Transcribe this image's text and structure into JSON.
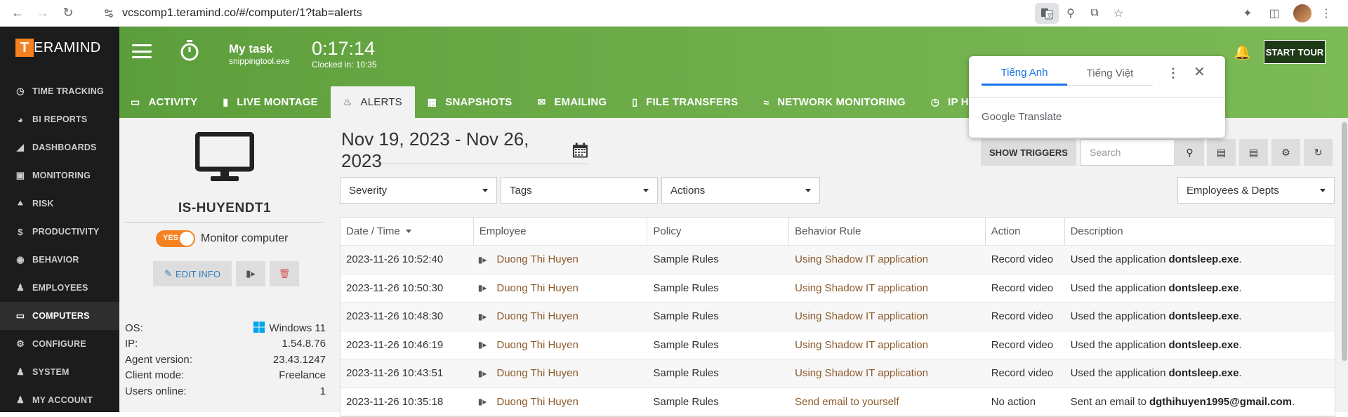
{
  "browser": {
    "url": "vcscomp1.teramind.co/#/computer/1?tab=alerts"
  },
  "sidebar": {
    "brand_letter": "T",
    "brand_name": "ERAMIND",
    "items": [
      {
        "label": "TIME TRACKING",
        "icon": "clock-icon"
      },
      {
        "label": "BI REPORTS",
        "icon": "pie-chart-icon"
      },
      {
        "label": "DASHBOARDS",
        "icon": "area-chart-icon"
      },
      {
        "label": "MONITORING",
        "icon": "monitoring-icon"
      },
      {
        "label": "RISK",
        "icon": "bolt-icon"
      },
      {
        "label": "PRODUCTIVITY",
        "icon": "dollar-icon"
      },
      {
        "label": "BEHAVIOR",
        "icon": "gamepad-icon"
      },
      {
        "label": "EMPLOYEES",
        "icon": "users-icon"
      },
      {
        "label": "COMPUTERS",
        "icon": "desktop-icon"
      },
      {
        "label": "CONFIGURE",
        "icon": "gear-icon"
      },
      {
        "label": "SYSTEM",
        "icon": "user-gear-icon"
      },
      {
        "label": "MY ACCOUNT",
        "icon": "account-icon"
      }
    ]
  },
  "header": {
    "task_name": "My task",
    "task_exe": "snippingtool.exe",
    "clock_time": "0:17:14",
    "clocked_in": "Clocked in: 10:35",
    "start_tour": "START TOUR",
    "tabs": [
      {
        "label": "ACTIVITY",
        "icon": "laptop-icon"
      },
      {
        "label": "LIVE MONTAGE",
        "icon": "video-icon"
      },
      {
        "label": "ALERTS",
        "icon": "bell-icon"
      },
      {
        "label": "SNAPSHOTS",
        "icon": "image-icon"
      },
      {
        "label": "EMAILING",
        "icon": "envelope-icon"
      },
      {
        "label": "FILE TRANSFERS",
        "icon": "file-icon"
      },
      {
        "label": "NETWORK MONITORING",
        "icon": "wifi-icon"
      },
      {
        "label": "IP H",
        "icon": "history-icon"
      }
    ]
  },
  "translate_popup": {
    "tab_source": "Tiếng Anh",
    "tab_target": "Tiếng Việt",
    "brand": "Google Translate"
  },
  "computer": {
    "name": "IS-HUYENDT1",
    "toggle_text": "YES",
    "monitor_label": "Monitor computer",
    "edit_info": "EDIT INFO",
    "info": [
      {
        "label": "OS:",
        "value": "Windows 11"
      },
      {
        "label": "IP:",
        "value": "1.54.8.76"
      },
      {
        "label": "Agent version:",
        "value": "23.43.1247"
      },
      {
        "label": "Client mode:",
        "value": "Freelance"
      },
      {
        "label": "Users online:",
        "value": "1"
      }
    ]
  },
  "alerts": {
    "date_range": "Nov 19, 2023 - Nov 26, 2023",
    "show_triggers": "SHOW TRIGGERS",
    "search_placeholder": "Search",
    "filters": {
      "severity": "Severity",
      "tags": "Tags",
      "actions": "Actions",
      "employees": "Employees & Depts"
    },
    "columns": [
      "Date / Time",
      "Employee",
      "Policy",
      "Behavior Rule",
      "Action",
      "Description"
    ],
    "rows": [
      {
        "datetime": "2023-11-26 10:52:40",
        "employee": "Duong Thi Huyen",
        "policy": "Sample Rules",
        "rule": "Using Shadow IT application",
        "action": "Record video",
        "desc_prefix": "Used the application",
        "desc_bold": "dontsleep.exe",
        "desc_suffix": "."
      },
      {
        "datetime": "2023-11-26 10:50:30",
        "employee": "Duong Thi Huyen",
        "policy": "Sample Rules",
        "rule": "Using Shadow IT application",
        "action": "Record video",
        "desc_prefix": "Used the application",
        "desc_bold": "dontsleep.exe",
        "desc_suffix": "."
      },
      {
        "datetime": "2023-11-26 10:48:30",
        "employee": "Duong Thi Huyen",
        "policy": "Sample Rules",
        "rule": "Using Shadow IT application",
        "action": "Record video",
        "desc_prefix": "Used the application",
        "desc_bold": "dontsleep.exe",
        "desc_suffix": "."
      },
      {
        "datetime": "2023-11-26 10:46:19",
        "employee": "Duong Thi Huyen",
        "policy": "Sample Rules",
        "rule": "Using Shadow IT application",
        "action": "Record video",
        "desc_prefix": "Used the application",
        "desc_bold": "dontsleep.exe",
        "desc_suffix": "."
      },
      {
        "datetime": "2023-11-26 10:43:51",
        "employee": "Duong Thi Huyen",
        "policy": "Sample Rules",
        "rule": "Using Shadow IT application",
        "action": "Record video",
        "desc_prefix": "Used the application",
        "desc_bold": "dontsleep.exe",
        "desc_suffix": "."
      },
      {
        "datetime": "2023-11-26 10:35:18",
        "employee": "Duong Thi Huyen",
        "policy": "Sample Rules",
        "rule": "Send email to yourself",
        "action": "No action",
        "desc_prefix": "Sent an email to",
        "desc_bold": "dgthihuyen1995@gmail.com",
        "desc_suffix": "."
      }
    ]
  },
  "colors": {
    "accent_orange": "#f58220",
    "header_green": "#6cab48",
    "sidebar_bg": "#1c1c1c",
    "link_brown": "#8b5a2b"
  }
}
